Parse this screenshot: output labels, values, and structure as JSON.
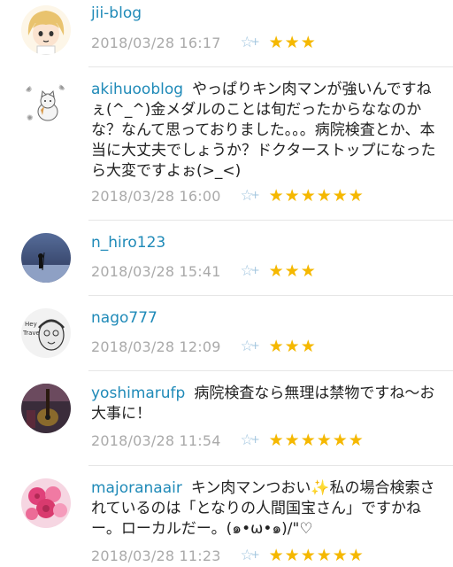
{
  "comments": [
    {
      "user": "jii-blog",
      "text": "",
      "date": "2018/03/28 16:17",
      "stars": "★★★",
      "avatar": "anime-girl-avatar"
    },
    {
      "user": "akihuooblog",
      "text": "やっぱりキン肉マンが強いんですねぇ(^_^)金メダルのことは旬だったからななのかな？なんて思っておりました。。。病院検査とか、本当に大丈夫でしょうか？ドクターストップになったら大変ですよぉ(>_<)",
      "date": "2018/03/28 16:00",
      "stars": "★★★★★★",
      "avatar": "cat-doodle-avatar"
    },
    {
      "user": "n_hiro123",
      "text": "",
      "date": "2018/03/28 15:41",
      "stars": "★★★",
      "avatar": "night-silhouette-avatar"
    },
    {
      "user": "nago777",
      "text": "",
      "date": "2018/03/28 12:09",
      "stars": "★★★",
      "avatar": "caricature-avatar"
    },
    {
      "user": "yoshimarufp",
      "text": "病院検査なら無理は禁物ですね～お大事に！",
      "date": "2018/03/28 11:54",
      "stars": "★★★★★★",
      "avatar": "guitar-avatar"
    },
    {
      "user": "majoranaair",
      "text_before": "キン肉マンつおい",
      "sparkle": "✨",
      "text_after": "私の場合検索されているのは「となりの人間国宝さん」ですかねー。ローカルだー。(๑•ω•๑)/\"♡",
      "date": "2018/03/28 11:23",
      "stars": "★★★★★★",
      "avatar": "roses-avatar"
    }
  ],
  "add_star_icon": "☆",
  "add_star_plus": "+",
  "colors": {
    "username": "#1f8ab8",
    "date": "#aaaaaa",
    "star": "#f5b800",
    "add_star": "#9fc4de"
  }
}
